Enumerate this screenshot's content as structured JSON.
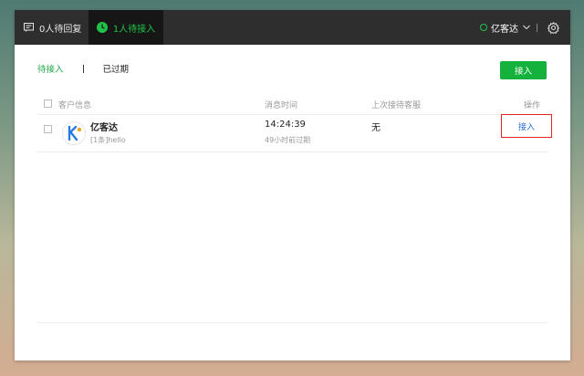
{
  "topbar": {
    "tab_pending_reply": "0人待回复",
    "tab_pending_accept": "1人待接入",
    "agent_name": "亿客达"
  },
  "subtabs": {
    "pending": "待接入",
    "expired": "已过期"
  },
  "accept_button": "接入",
  "table": {
    "headers": [
      "客户信息",
      "消息时间",
      "上次接待客服",
      "操作"
    ],
    "rows": [
      {
        "name": "亿客达",
        "message": "[1条]hello",
        "time": "14:24:39",
        "elapsed": "49小时前过期",
        "last_agent": "无",
        "action": "接入"
      }
    ]
  },
  "colors": {
    "accent_green": "#21c24a",
    "button_green": "#14b13c",
    "link_blue": "#2a6fd6",
    "highlight_red": "#e02525"
  }
}
